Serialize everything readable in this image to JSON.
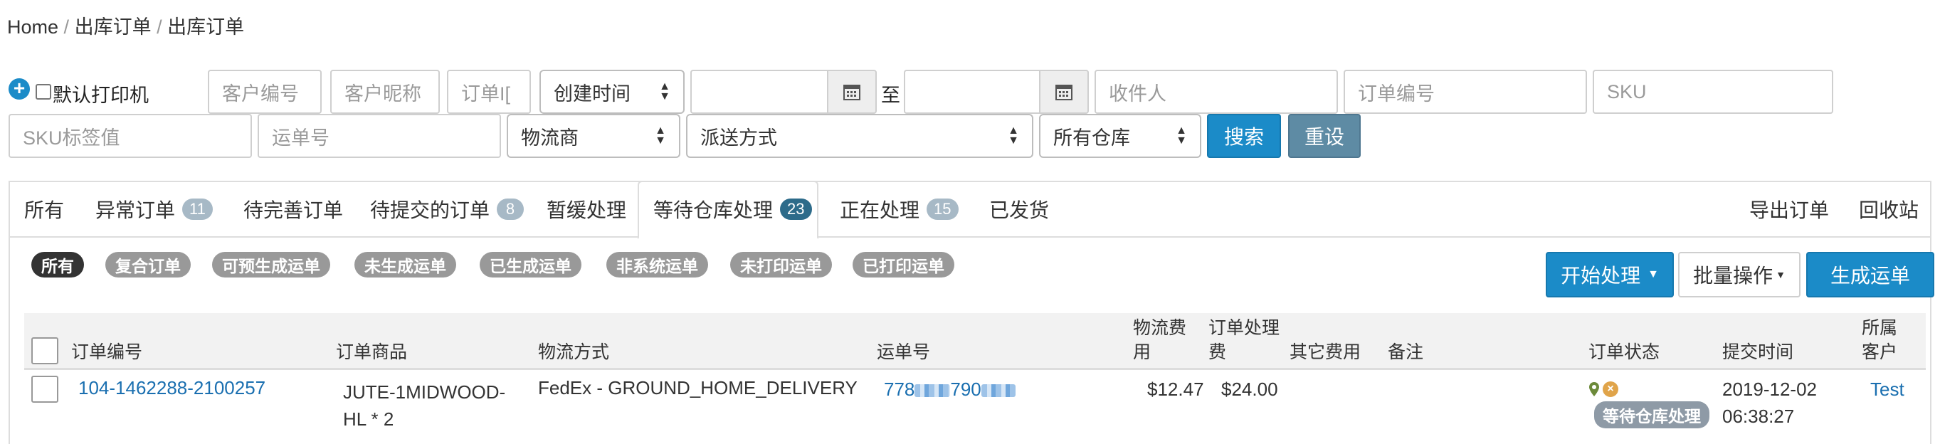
{
  "breadcrumb": [
    "Home",
    "出库订单",
    "出库订单"
  ],
  "filters": {
    "default_printer_label": "默认打印机",
    "customer_code_placeholder": "客户编号",
    "customer_nickname_placeholder": "客户昵称",
    "order_id_placeholder": "订单I[",
    "date_type_value": "创建时间",
    "to_label": "至",
    "recipient_placeholder": "收件人",
    "order_number_placeholder": "订单编号",
    "sku_placeholder": "SKU",
    "sku_tag_placeholder": "SKU标签值",
    "tracking_placeholder": "运单号",
    "carrier_value": "物流商",
    "delivery_value": "派送方式",
    "warehouse_value": "所有仓库",
    "search_label": "搜索",
    "reset_label": "重设"
  },
  "tabs": [
    {
      "label": "所有",
      "badge": ""
    },
    {
      "label": "异常订单",
      "badge": "11"
    },
    {
      "label": "待完善订单",
      "badge": ""
    },
    {
      "label": "待提交的订单",
      "badge": "8"
    },
    {
      "label": "暂缓处理",
      "badge": ""
    },
    {
      "label": "等待仓库处理",
      "badge": "23"
    },
    {
      "label": "正在处理",
      "badge": "15"
    },
    {
      "label": "已发货",
      "badge": ""
    }
  ],
  "tab_actions": {
    "export": "导出订单",
    "recycle": "回收站"
  },
  "pills": [
    "所有",
    "复合订单",
    "可预生成运单",
    "未生成运单",
    "已生成运单",
    "非系统运单",
    "未打印运单",
    "已打印运单"
  ],
  "actions": {
    "start": "开始处理",
    "batch": "批量操作",
    "generate": "生成运单"
  },
  "table": {
    "headers": {
      "order_no": "订单编号",
      "product": "订单商品",
      "shipping": "物流方式",
      "tracking": "运单号",
      "freight_1": "物流费",
      "freight_2": "用",
      "handling_1": "订单处理",
      "handling_2": "费",
      "other_fee": "其它费用",
      "remark": "备注",
      "status": "订单状态",
      "submit_time": "提交时间",
      "customer_1": "所属",
      "customer_2": "客户"
    },
    "rows": [
      {
        "order_no": "104-1462288-2100257",
        "product_1": "JUTE-1MIDWOOD-",
        "product_2": "HL * 2",
        "shipping": "FedEx - GROUND_HOME_DELIVERY",
        "tracking_a": "778",
        "tracking_b": "790",
        "freight": "$12.47",
        "handling": "$24.00",
        "status": "等待仓库处理",
        "date": "2019-12-02",
        "time": "06:38:27",
        "customer": "Test"
      }
    ]
  },
  "colors": {
    "primary": "#1b8bc8",
    "reset": "#5e8ba4",
    "link": "#1a6fb0",
    "pill": "#999999"
  }
}
